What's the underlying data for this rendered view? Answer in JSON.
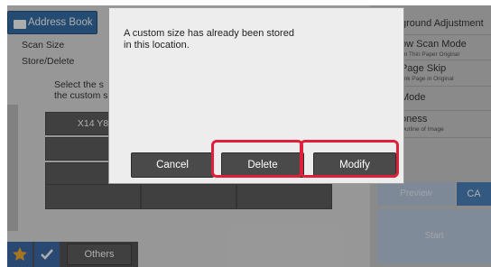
{
  "header": {
    "address_book_label": "Address Book"
  },
  "left_menu": {
    "scan_size": "Scan Size",
    "store_delete": "Store/Delete",
    "instruction_line1": "Select the s",
    "instruction_line2": "the custom s",
    "size_button_1": "X14 Y8"
  },
  "right_menu": [
    {
      "title": "ground Adjustment",
      "sub": ""
    },
    {
      "title": "ow Scan Mode",
      "sub": "an Thin Paper Original"
    },
    {
      "title": "Page Skip",
      "sub": "ank Page in Original"
    },
    {
      "title": "Mode",
      "sub": ""
    },
    {
      "title": "oness",
      "sub": "Outline of Image"
    }
  ],
  "actions": {
    "preview": "Preview",
    "ca": "CA",
    "start": "Start"
  },
  "bottom_bar": {
    "others_label": "Others"
  },
  "dialog": {
    "message_line1": "A custom size has already been stored",
    "message_line2": "in this location.",
    "cancel": "Cancel",
    "delete": "Delete",
    "modify": "Modify"
  },
  "colors": {
    "highlight": "#e0203a",
    "accent_blue": "#22619e",
    "ca_blue": "#3d78b8"
  }
}
